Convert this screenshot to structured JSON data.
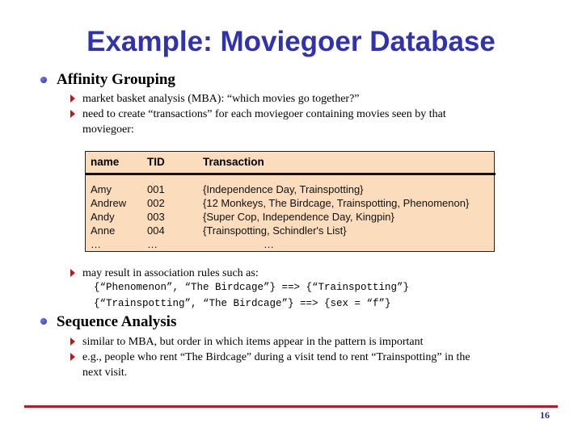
{
  "slide": {
    "title": "Example: Moviegoer Database",
    "page_number": "16"
  },
  "affinity": {
    "heading": "Affinity Grouping",
    "points": [
      "market basket analysis (MBA): “which movies go together?”",
      "need to create “transactions” for each moviegoer containing movies seen by that",
      "moviegoer:"
    ],
    "table": {
      "headers": [
        "name",
        "TID",
        "Transaction"
      ],
      "names": [
        "Amy",
        "Andrew",
        "Andy",
        "Anne",
        "…"
      ],
      "tids": [
        "001",
        "002",
        "003",
        "004",
        "…"
      ],
      "transactions": [
        "{Independence Day, Trainspotting}",
        "{12 Monkeys, The Birdcage, Trainspotting, Phenomenon}",
        "{Super Cop, Independence Day, Kingpin}",
        "{Trainspotting, Schindler's List}",
        "…"
      ]
    },
    "rules_intro": "may result in association rules such as:",
    "rules": [
      "{“Phenomenon”, “The Birdcage”} ==> {“Trainspotting”}",
      "{“Trainspotting”, “The Birdcage”} ==> {sex = “f”}"
    ]
  },
  "sequence": {
    "heading": "Sequence Analysis",
    "points": [
      "similar to MBA, but order in which items appear in the pattern is important",
      "e.g., people who rent “The Birdcage” during a visit tend to rent “Trainspotting” in the",
      "next visit."
    ]
  }
}
